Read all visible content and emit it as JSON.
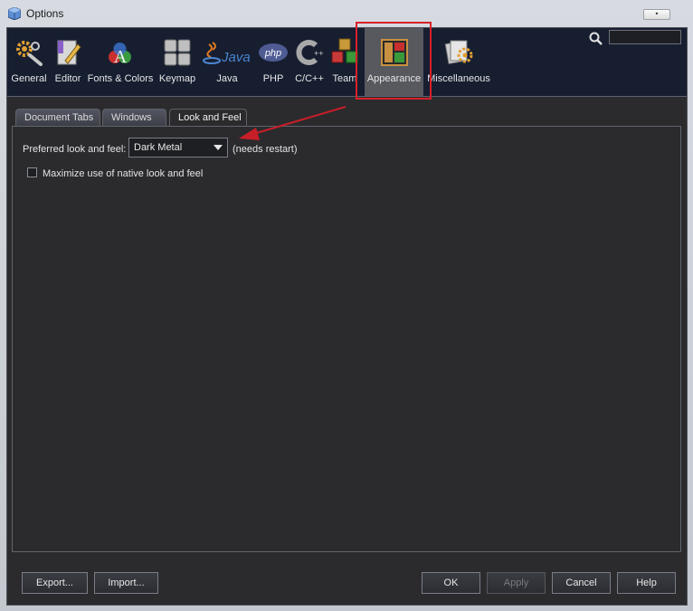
{
  "window": {
    "title": "Options",
    "title_button": "•"
  },
  "categories": [
    {
      "label": "General",
      "icon": "gears-icon"
    },
    {
      "label": "Editor",
      "icon": "editor-pencil-icon"
    },
    {
      "label": "Fonts & Colors",
      "icon": "fonts-colors-icon"
    },
    {
      "label": "Keymap",
      "icon": "keymap-icon"
    },
    {
      "label": "Java",
      "icon": "java-icon"
    },
    {
      "label": "PHP",
      "icon": "php-icon"
    },
    {
      "label": "C/C++",
      "icon": "cpp-icon"
    },
    {
      "label": "Team",
      "icon": "team-cubes-icon"
    },
    {
      "label": "Appearance",
      "icon": "appearance-layout-icon",
      "selected": true
    },
    {
      "label": "Miscellaneous",
      "icon": "miscellaneous-icon"
    }
  ],
  "search": {
    "value": ""
  },
  "tabs": [
    {
      "label": "Document Tabs"
    },
    {
      "label": "Windows"
    },
    {
      "label": "Look and Feel",
      "active": true
    }
  ],
  "look_and_feel": {
    "preferred_label": "Preferred look and feel:",
    "selected_value": "Dark Metal",
    "restart_note": "(needs restart)",
    "native_checkbox_label": "Maximize use of native look and feel",
    "native_checked": false
  },
  "buttons": {
    "export": "Export...",
    "import": "Import...",
    "ok": "OK",
    "apply": "Apply",
    "cancel": "Cancel",
    "help": "Help"
  },
  "colors": {
    "toolbar_bg": "#161e30",
    "panel_bg": "#2b2b2e",
    "annotation": "#d8202a",
    "selected_category": "#58595f"
  }
}
